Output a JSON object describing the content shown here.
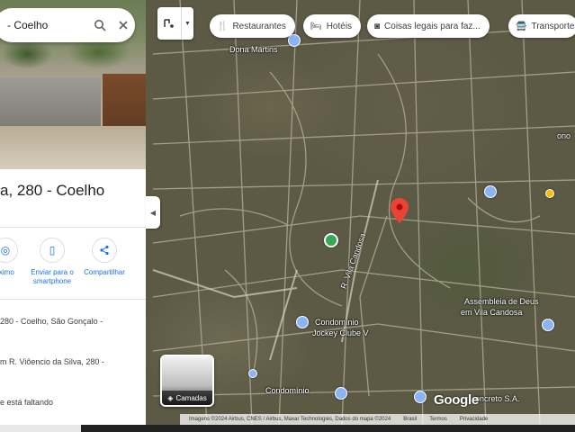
{
  "search": {
    "query": "- Coelho"
  },
  "place": {
    "title": "a, 280 - Coelho",
    "address": "280 - Coelho, São Gonçalo -",
    "street_row": "m R. Viôencio da Silva, 280 -",
    "missing_row": "e está faltando"
  },
  "actions": [
    {
      "label": "rximo",
      "icon": "nearby-icon"
    },
    {
      "label": "Enviar para o smartphone",
      "icon": "smartphone-icon"
    },
    {
      "label": "Compartilhar",
      "icon": "share-icon"
    }
  ],
  "chips": [
    {
      "label": "Restaurantes",
      "icon": "restaurant-icon"
    },
    {
      "label": "Hotéis",
      "icon": "hotel-icon"
    },
    {
      "label": "Coisas legais para faz...",
      "icon": "camera-icon"
    },
    {
      "label": "Transporte",
      "icon": "transit-icon"
    }
  ],
  "map_labels": {
    "top": "Dona Martins",
    "assembleia": "Assembleia de Deus",
    "assembleia2": "em Vila Candosa",
    "condominio": "Condomínio",
    "condominio2": "Jockey Clube V",
    "right": "ono",
    "street": "R. Vila Candosa",
    "bottom": "Condomínio",
    "concreto": "oncreto S.A."
  },
  "streetview": {
    "label": "Camadas"
  },
  "logo": "Google",
  "attribution": [
    "Imagens ©2024 Airbus, CNES / Airbus, Maxar Technologies, Dados do mapa ©2024",
    "Brasil",
    "Termos",
    "Privacidade"
  ],
  "colors": {
    "accent": "#1a73e8",
    "pin": "#ea4335",
    "poi_green": "#34a853"
  }
}
